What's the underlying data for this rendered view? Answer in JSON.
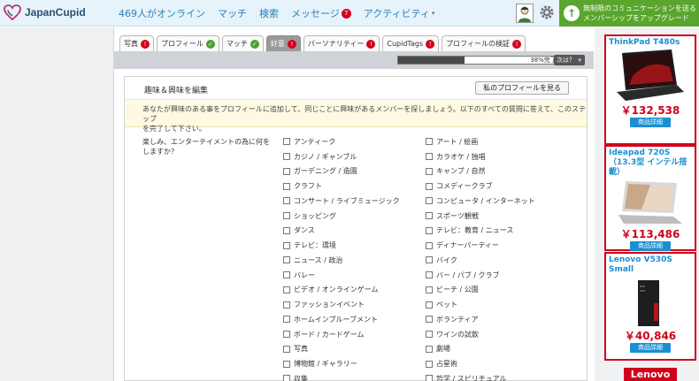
{
  "header": {
    "logo_text": "JapanCupid",
    "nav": [
      {
        "label": "469人がオンライン",
        "badge": ""
      },
      {
        "label": "マッチ",
        "badge": ""
      },
      {
        "label": "検索",
        "badge": ""
      },
      {
        "label": "メッセージ",
        "badge": "7"
      },
      {
        "label": "アクティビティ",
        "badge": ""
      }
    ],
    "upgrade_line1": "無制限のコミュニケーションを送る",
    "upgrade_line2": "メンバーシップをアップグレード"
  },
  "tabs": [
    {
      "label": "写真",
      "status": "!"
    },
    {
      "label": "プロフィール",
      "status": "✓"
    },
    {
      "label": "マッチ",
      "status": "✓"
    },
    {
      "label": "好意",
      "status": "!"
    },
    {
      "label": "パーソナリティー",
      "status": "!"
    },
    {
      "label": "CupidTags",
      "status": "!"
    },
    {
      "label": "プロフィールの検証",
      "status": "!"
    }
  ],
  "progress": {
    "label": "38%完了",
    "percent": 38,
    "next_label": "次は？ +"
  },
  "panel": {
    "title": "趣味＆興味を編集",
    "view_profile": "私のプロフィールを見る",
    "notice_line1": "あなたが興味のある事をプロフィールに追加して、同じことに興味があるメンバーを探しましょう。以下のすべての質問に答えて、このステップ",
    "notice_line2": "を完了して下さい。",
    "question": "楽しみ、エンターテイメントの為に何をしますか？",
    "options_col1": [
      "アンティーク",
      "カジノ / ギャンブル",
      "ガーデニング / 造園",
      "クラフト",
      "コンサート / ライブミュージック",
      "ショッピング",
      "ダンス",
      "テレビ：環境",
      "ニュース / 政治",
      "バレー",
      "ビデオ / オンラインゲーム",
      "ファッションイベント",
      "ホームインプルーブメント",
      "ボード / カードゲーム",
      "写真",
      "博物館 / ギャラリー",
      "収集"
    ],
    "options_col2": [
      "アート / 絵画",
      "カラオケ / 独唱",
      "キャンプ / 自然",
      "コメディークラブ",
      "コンピュータ / インターネット",
      "スポーツ観戦",
      "テレビ：教育 / ニュース",
      "ディナーパーティー",
      "バイク",
      "バー / パブ / クラブ",
      "ビーチ / 公園",
      "ペット",
      "ボランティア",
      "ワインの試飲",
      "劇場",
      "占星術",
      "哲学 / スピリチュアル"
    ]
  },
  "ads": [
    {
      "title": "ThinkPad T480s",
      "price": "￥132,538",
      "detail": "商品詳細"
    },
    {
      "title": "Ideapad 720S（13.3型 インテル搭載）",
      "price": "￥113,486",
      "detail": "商品詳細"
    },
    {
      "title": "Lenovo V530S Small",
      "price": "￥40,846",
      "detail": "商品詳細"
    }
  ],
  "ad_brand": "Lenovo",
  "colors": {
    "accent": "#2a7fb9",
    "upgrade": "#5aa52d",
    "badge": "#d0021b",
    "ad_border": "#d0021b"
  }
}
